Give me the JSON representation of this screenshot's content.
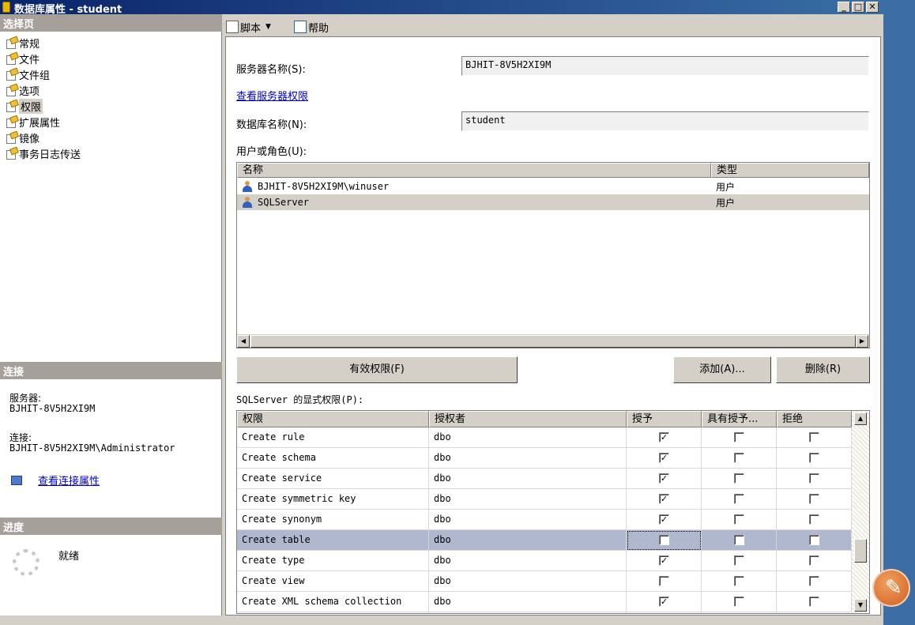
{
  "window": {
    "title": "数据库属性 - student"
  },
  "left_panel": {
    "select_page_header": "选择页",
    "pages": [
      {
        "label": "常规"
      },
      {
        "label": "文件"
      },
      {
        "label": "文件组"
      },
      {
        "label": "选项"
      },
      {
        "label": "权限"
      },
      {
        "label": "扩展属性"
      },
      {
        "label": "镜像"
      },
      {
        "label": "事务日志传送"
      }
    ],
    "selected_page": "权限",
    "connection_header": "连接",
    "server_label": "服务器:",
    "server_value": "BJHIT-8V5H2XI9M",
    "connection_label": "连接:",
    "connection_value": "BJHIT-8V5H2XI9M\\Administrator",
    "view_connection_link": "查看连接属性",
    "progress_header": "进度",
    "progress_status": "就绪"
  },
  "toolbar": {
    "script_label": "脚本",
    "help_label": "帮助"
  },
  "form": {
    "server_name_label": "服务器名称(S):",
    "server_name_value": "BJHIT-8V5H2XI9M",
    "view_server_permissions_link": "查看服务器权限",
    "database_name_label": "数据库名称(N):",
    "database_name_value": "student",
    "users_roles_label": "用户或角色(U):"
  },
  "users_table": {
    "columns": [
      "名称",
      "类型"
    ],
    "rows": [
      {
        "name": "BJHIT-8V5H2XI9M\\winuser",
        "type": "用户",
        "selected": false
      },
      {
        "name": "SQLServer",
        "type": "用户",
        "selected": true
      }
    ]
  },
  "buttons": {
    "effective_permissions": "有效权限(F)",
    "add": "添加(A)...",
    "remove": "删除(R)"
  },
  "permissions": {
    "label": "SQLServer 的显式权限(P):",
    "columns": [
      "权限",
      "授权者",
      "授予",
      "具有授予...",
      "拒绝"
    ],
    "rows": [
      {
        "permission": "Create rule",
        "grantor": "dbo",
        "grant": true,
        "with_grant": false,
        "deny": false,
        "selected": false
      },
      {
        "permission": "Create schema",
        "grantor": "dbo",
        "grant": true,
        "with_grant": false,
        "deny": false,
        "selected": false
      },
      {
        "permission": "Create service",
        "grantor": "dbo",
        "grant": true,
        "with_grant": false,
        "deny": false,
        "selected": false
      },
      {
        "permission": "Create symmetric key",
        "grantor": "dbo",
        "grant": true,
        "with_grant": false,
        "deny": false,
        "selected": false
      },
      {
        "permission": "Create synonym",
        "grantor": "dbo",
        "grant": true,
        "with_grant": false,
        "deny": false,
        "selected": false
      },
      {
        "permission": "Create table",
        "grantor": "dbo",
        "grant": false,
        "with_grant": false,
        "deny": false,
        "selected": true
      },
      {
        "permission": "Create type",
        "grantor": "dbo",
        "grant": true,
        "with_grant": false,
        "deny": false,
        "selected": false
      },
      {
        "permission": "Create view",
        "grantor": "dbo",
        "grant": false,
        "with_grant": false,
        "deny": false,
        "selected": false
      },
      {
        "permission": "Create XML schema collection",
        "grantor": "dbo",
        "grant": true,
        "with_grant": false,
        "deny": false,
        "selected": false
      }
    ]
  },
  "colors": {
    "title_start": "#0a246a",
    "title_end": "#3a6ea5",
    "link": "#0000cc",
    "selected_row": "#b0b8d0",
    "desktop": "#3c6ea5"
  }
}
